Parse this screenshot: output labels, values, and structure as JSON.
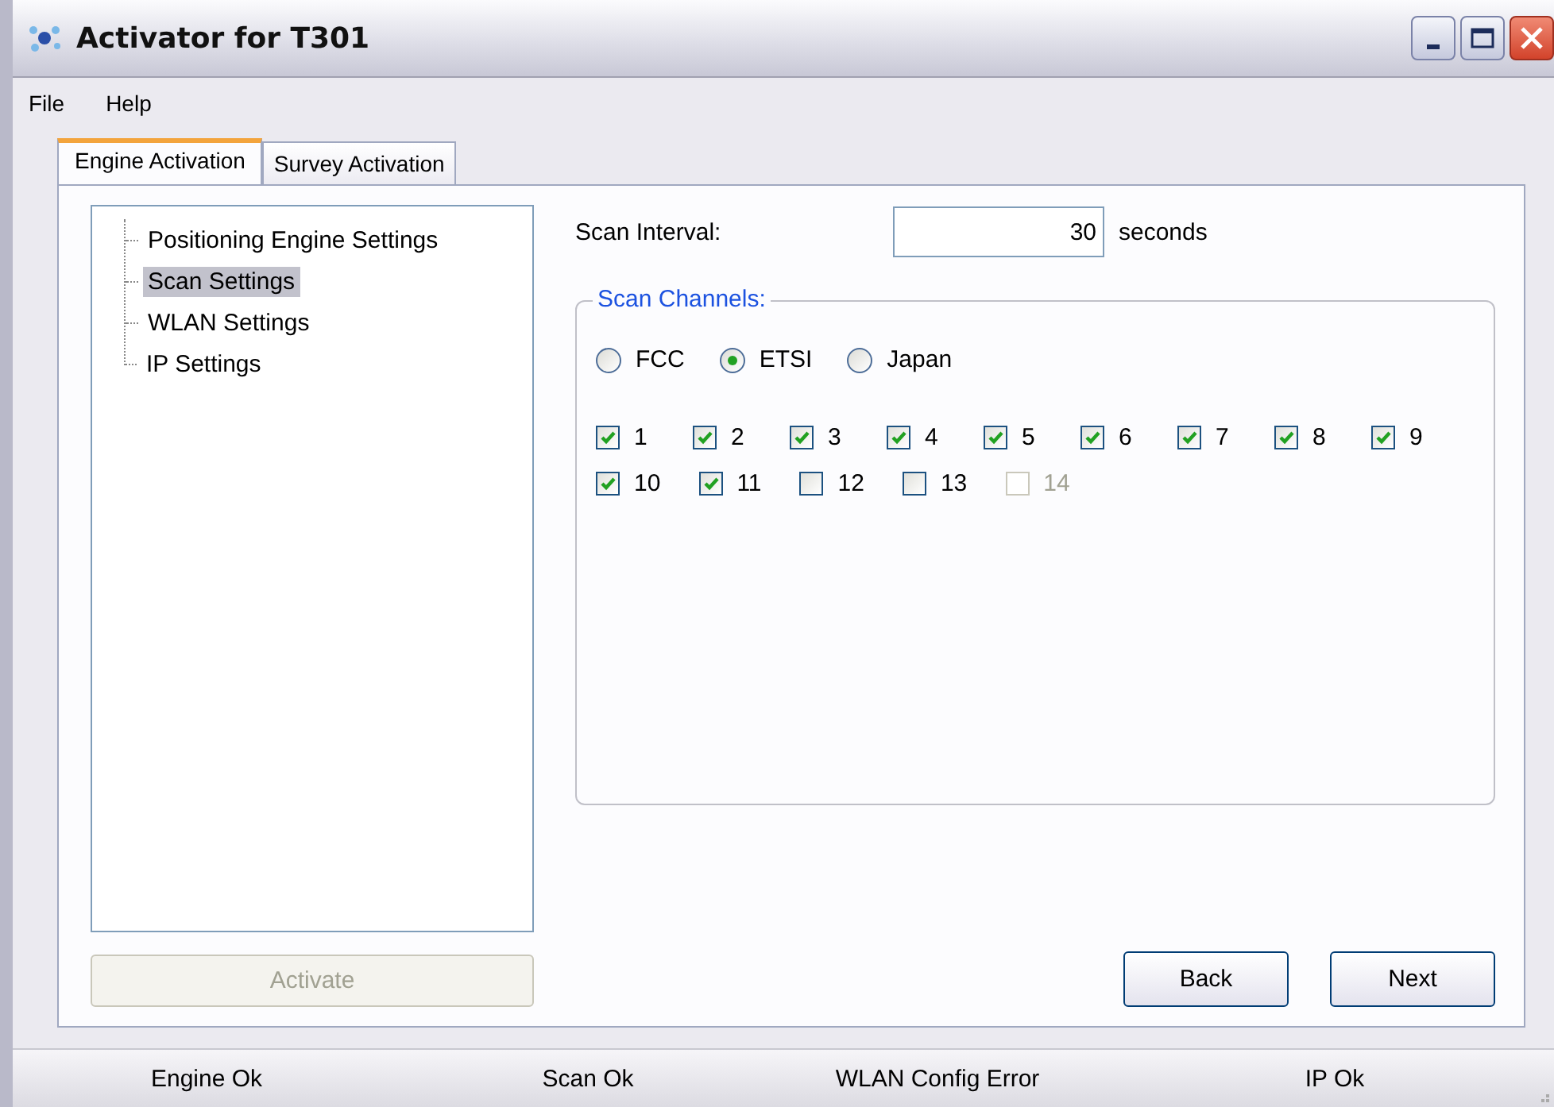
{
  "window": {
    "title": "Activator for T301"
  },
  "menu": [
    {
      "label": "File"
    },
    {
      "label": "Help"
    }
  ],
  "tabs": [
    {
      "label": "Engine Activation",
      "selected": true
    },
    {
      "label": "Survey Activation",
      "selected": false
    }
  ],
  "tree": [
    {
      "label": "Positioning Engine Settings",
      "selected": false
    },
    {
      "label": "Scan Settings",
      "selected": true
    },
    {
      "label": "WLAN Settings",
      "selected": false
    },
    {
      "label": "IP Settings",
      "selected": false
    }
  ],
  "activate_button": {
    "label": "Activate",
    "disabled": true
  },
  "scan_interval": {
    "label": "Scan Interval:",
    "value": "30",
    "unit": "seconds"
  },
  "scan_channels": {
    "title": "Scan Channels:",
    "regions": [
      {
        "label": "FCC",
        "selected": false
      },
      {
        "label": "ETSI",
        "selected": true
      },
      {
        "label": "Japan",
        "selected": false
      }
    ],
    "channels": [
      {
        "label": "1",
        "checked": true,
        "disabled": false
      },
      {
        "label": "2",
        "checked": true,
        "disabled": false
      },
      {
        "label": "3",
        "checked": true,
        "disabled": false
      },
      {
        "label": "4",
        "checked": true,
        "disabled": false
      },
      {
        "label": "5",
        "checked": true,
        "disabled": false
      },
      {
        "label": "6",
        "checked": true,
        "disabled": false
      },
      {
        "label": "7",
        "checked": true,
        "disabled": false
      },
      {
        "label": "8",
        "checked": true,
        "disabled": false
      },
      {
        "label": "9",
        "checked": true,
        "disabled": false
      },
      {
        "label": "10",
        "checked": true,
        "disabled": false
      },
      {
        "label": "11",
        "checked": true,
        "disabled": false
      },
      {
        "label": "12",
        "checked": false,
        "disabled": false
      },
      {
        "label": "13",
        "checked": false,
        "disabled": false
      },
      {
        "label": "14",
        "checked": false,
        "disabled": true
      }
    ]
  },
  "buttons": [
    {
      "label": "Back"
    },
    {
      "label": "Next"
    }
  ],
  "status_bar": [
    {
      "text": "Engine Ok"
    },
    {
      "text": "Scan Ok"
    },
    {
      "text": "WLAN Config Error"
    },
    {
      "text": "IP Ok"
    }
  ]
}
